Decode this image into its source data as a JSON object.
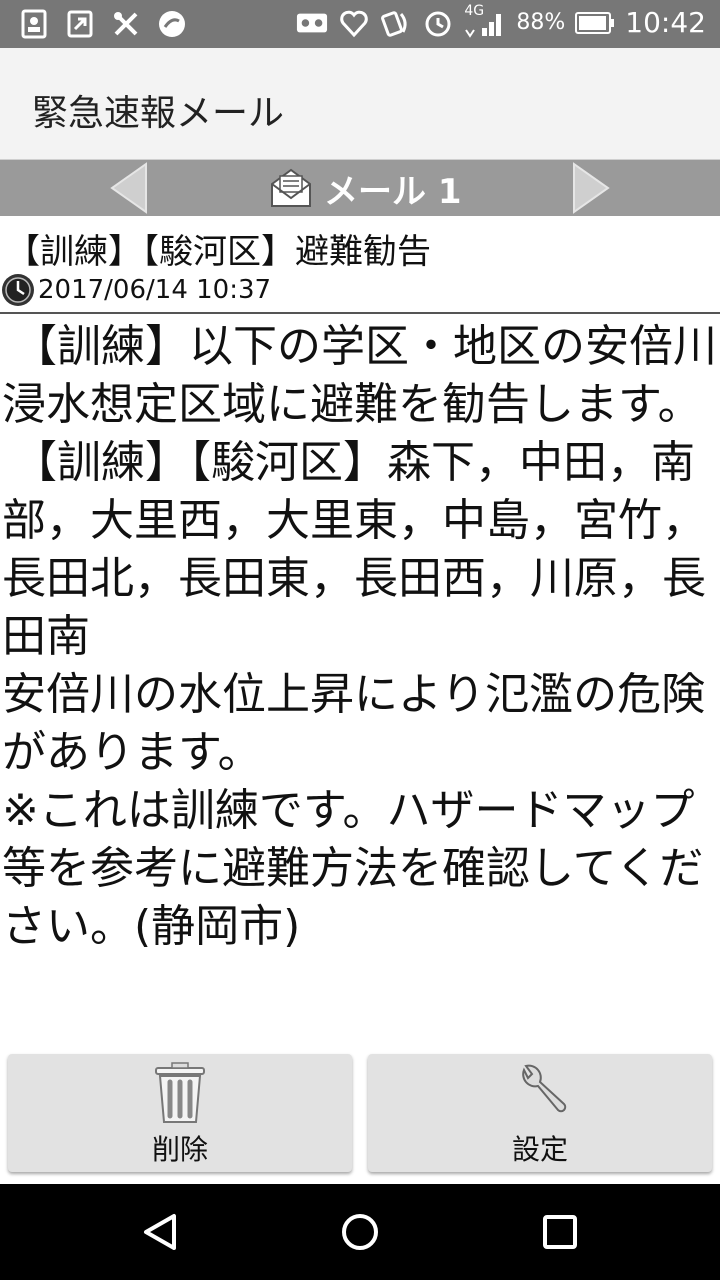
{
  "status_bar": {
    "left_icons": [
      "contacts-icon",
      "app-icon",
      "tools-icon",
      "emoji-icon"
    ],
    "right_icons": [
      "voicemail-icon",
      "heart-rate-icon",
      "nfc-icon",
      "alarm-icon"
    ],
    "network": "4G",
    "battery": "88%",
    "time": "10:42"
  },
  "app_bar": {
    "title": "緊急速報メール"
  },
  "mail_nav": {
    "label": "メール 1"
  },
  "mail": {
    "subject": "【訓練】【駿河区】避難勧告",
    "date": "2017/06/14 10:37",
    "body": [
      "【訓練】以下の学区・地区の安倍川浸水想定区域に避難を勧告します。",
      "【訓練】【駿河区】森下，中田，南部，大里西，大里東，中島，宮竹，長田北，長田東，長田西，川原，長田南",
      "安倍川の水位上昇により氾濫の危険があります。",
      "※これは訓練です。ハザードマップ等を参考に避難方法を確認してください。(静岡市)"
    ]
  },
  "buttons": {
    "delete_label": "削除",
    "settings_label": "設定"
  },
  "colors": {
    "status_bar": "#777777",
    "nav_strip": "#9a9a9a",
    "button_bg": "#e2e2e2",
    "system_nav": "#000000"
  }
}
